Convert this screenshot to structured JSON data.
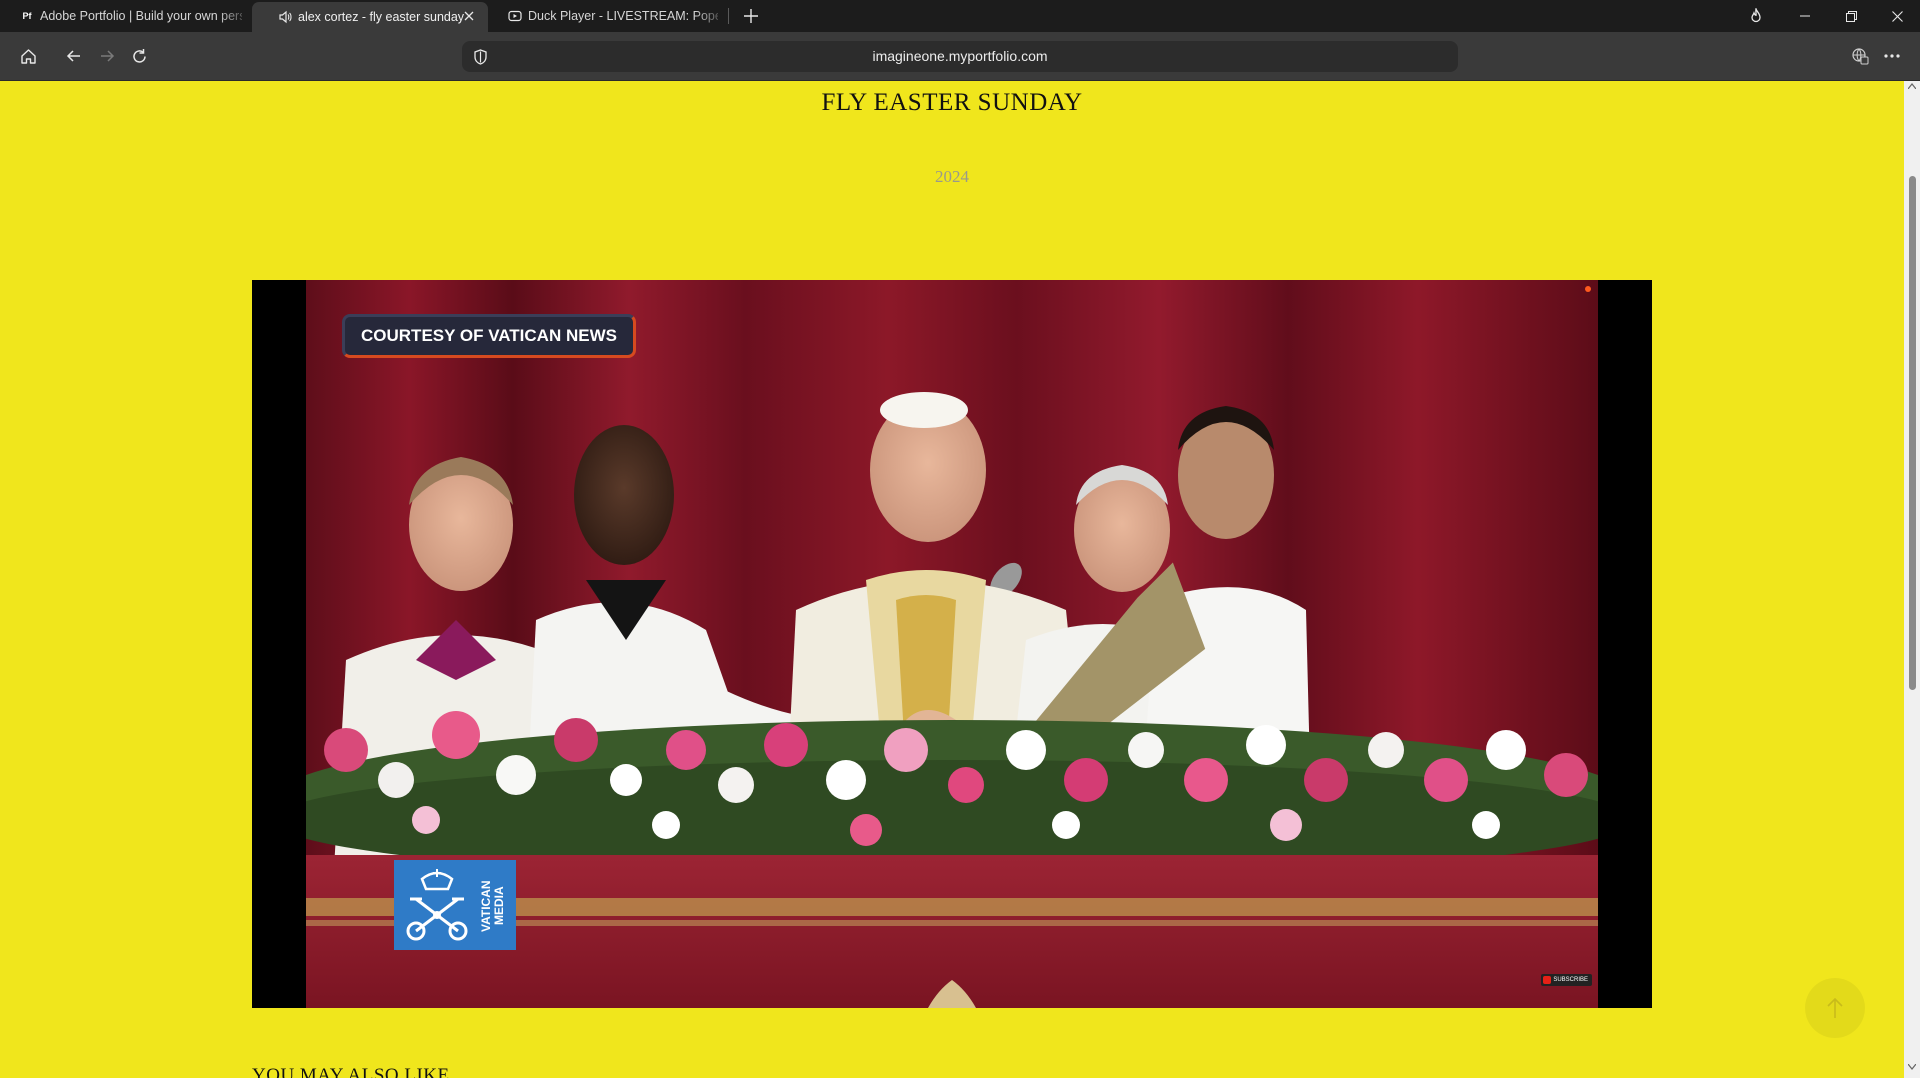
{
  "browser": {
    "tabs": [
      {
        "title": "Adobe Portfolio | Build your own personal website",
        "favicon": "adobe-portfolio-icon",
        "active": false
      },
      {
        "title": "alex cortez - fly easter sunday",
        "favicon": "speaker-icon",
        "active": true,
        "close_icon": "close-icon"
      },
      {
        "title": "Duck Player - LIVESTREAM: Pope Francis",
        "favicon": "duck-player-icon",
        "active": false
      }
    ],
    "favicon_text": {
      "adobe": "Pf"
    },
    "url": "imagineone.myportfolio.com",
    "colors": {
      "tabbar": "#1c1c1c",
      "toolbar": "#3a3a3a",
      "address_bar": "#2c2c2c"
    }
  },
  "page": {
    "title": "FLY EASTER SUNDAY",
    "year": "2024",
    "background": "#f0e61c",
    "video": {
      "badge": "COURTESY OF VATICAN NEWS",
      "logo_text": "VATICAN MEDIA",
      "subscribe": "SUBSCRIBE"
    },
    "section_heading": "YOU MAY ALSO LIKE"
  }
}
